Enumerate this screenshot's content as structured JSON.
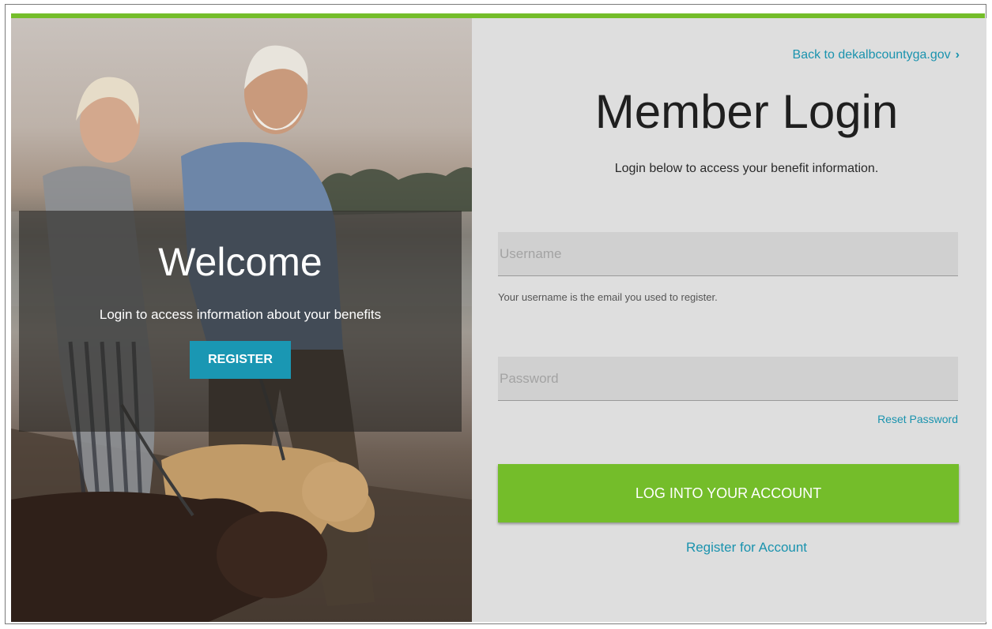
{
  "welcome_panel": {
    "title": "Welcome",
    "subtitle": "Login to access information about your benefits",
    "register_button": "REGISTER"
  },
  "login": {
    "back_link": "Back to dekalbcountyga.gov",
    "title": "Member Login",
    "subtitle": "Login below to access your benefit information.",
    "username_placeholder": "Username",
    "username_hint": "Your username is the email you used to register.",
    "password_placeholder": "Password",
    "reset_password": "Reset Password",
    "login_button": "LOG INTO YOUR ACCOUNT",
    "register_link": "Register for Account"
  },
  "colors": {
    "accent_green": "#74bd2a",
    "link_blue": "#1a93ae",
    "register_blue": "#1a97b3",
    "panel_gray": "#dedede"
  }
}
